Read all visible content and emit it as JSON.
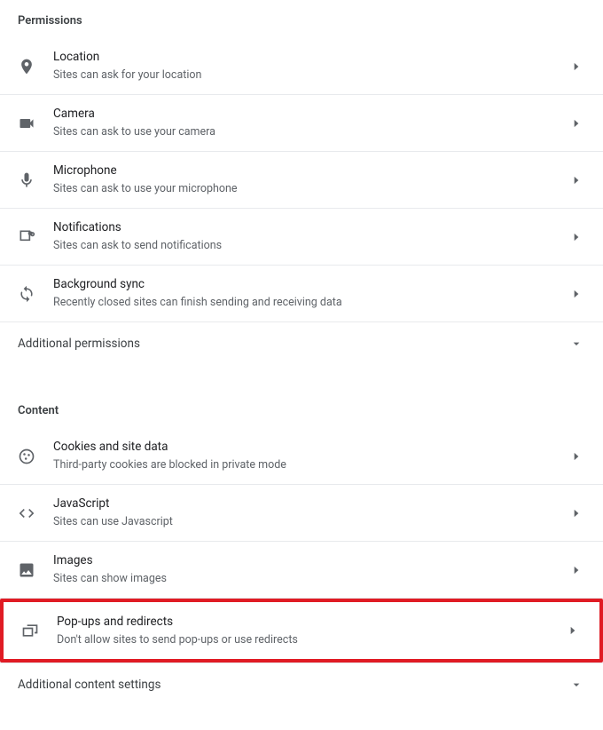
{
  "permissions": {
    "header": "Permissions",
    "items": [
      {
        "title": "Location",
        "subtitle": "Sites can ask for your location"
      },
      {
        "title": "Camera",
        "subtitle": "Sites can ask to use your camera"
      },
      {
        "title": "Microphone",
        "subtitle": "Sites can ask to use your microphone"
      },
      {
        "title": "Notifications",
        "subtitle": "Sites can ask to send notifications"
      },
      {
        "title": "Background sync",
        "subtitle": "Recently closed sites can finish sending and receiving data"
      }
    ],
    "expander": "Additional permissions"
  },
  "content": {
    "header": "Content",
    "items": [
      {
        "title": "Cookies and site data",
        "subtitle": "Third-party cookies are blocked in private mode"
      },
      {
        "title": "JavaScript",
        "subtitle": "Sites can use Javascript"
      },
      {
        "title": "Images",
        "subtitle": "Sites can show images"
      },
      {
        "title": "Pop-ups and redirects",
        "subtitle": "Don't allow sites to send pop-ups or use redirects"
      }
    ],
    "expander": "Additional content settings"
  }
}
